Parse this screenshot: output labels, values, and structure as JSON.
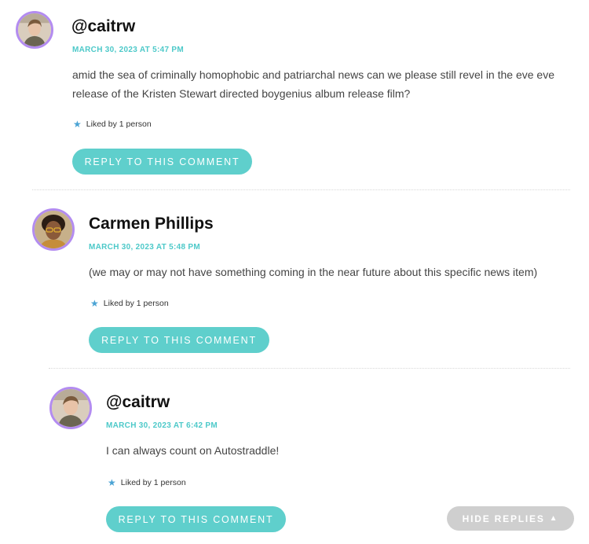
{
  "comments": [
    {
      "author": "@caitrw",
      "date": "MARCH 30, 2023 AT 5:47 PM",
      "text": "amid the sea of criminally homophobic and patriarchal news can we please still revel in the eve eve release of the Kristen Stewart directed boygenius album release film?",
      "likes": "Liked by 1 person",
      "reply_label": "REPLY TO THIS COMMENT"
    },
    {
      "author": "Carmen Phillips",
      "date": "MARCH 30, 2023 AT 5:48 PM",
      "text": "(we may or may not have something coming in the near future about this specific news item)",
      "likes": "Liked by 1 person",
      "reply_label": "REPLY TO THIS COMMENT"
    },
    {
      "author": "@caitrw",
      "date": "MARCH 30, 2023 AT 6:42 PM",
      "text": "I can always count on Autostraddle!",
      "likes": "Liked by 1 person",
      "reply_label": "REPLY TO THIS COMMENT"
    }
  ],
  "hide_replies": {
    "label": "HIDE REPLIES"
  },
  "icons": {
    "like": "star-icon",
    "hide": "triangle-up-icon",
    "avatar": "user-avatar"
  },
  "colors": {
    "accent": "#5fcfcc",
    "date": "#4dc9c9",
    "avatar_ring": "#b38cf0",
    "star": "#4aa3d4",
    "hide_button": "#cfcfcf"
  }
}
